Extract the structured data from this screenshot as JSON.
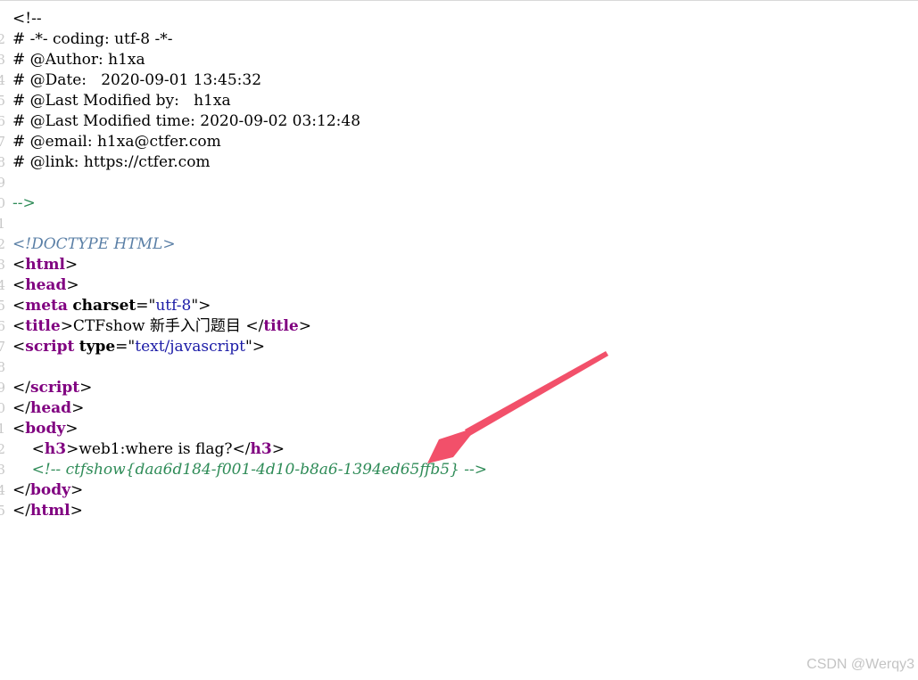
{
  "source": {
    "lines": [
      {
        "n": "",
        "parts": [
          {
            "t": "<!--",
            "c": "br"
          }
        ]
      },
      {
        "n": "2",
        "parts": [
          {
            "t": "# -*- coding: utf-8 -*-",
            "c": "br"
          }
        ]
      },
      {
        "n": "3",
        "parts": [
          {
            "t": "# @Author: h1xa",
            "c": "br"
          }
        ]
      },
      {
        "n": "4",
        "parts": [
          {
            "t": "# @Date:   2020-09-01 13:45:32",
            "c": "br"
          }
        ]
      },
      {
        "n": "5",
        "parts": [
          {
            "t": "# @Last Modified by:   h1xa",
            "c": "br"
          }
        ]
      },
      {
        "n": "6",
        "parts": [
          {
            "t": "# @Last Modified time: 2020-09-02 03:12:48",
            "c": "br"
          }
        ]
      },
      {
        "n": "7",
        "parts": [
          {
            "t": "# @email: h1xa@ctfer.com",
            "c": "br"
          }
        ]
      },
      {
        "n": "8",
        "parts": [
          {
            "t": "# @link: https://ctfer.com",
            "c": "br"
          }
        ]
      },
      {
        "n": "9",
        "parts": []
      },
      {
        "n": "0",
        "parts": [
          {
            "t": "-->",
            "c": "cmt"
          }
        ]
      },
      {
        "n": "1",
        "parts": []
      },
      {
        "n": "2",
        "parts": [
          {
            "t": "<!DOCTYPE HTML>",
            "c": "doct"
          }
        ]
      },
      {
        "n": "3",
        "parts": [
          {
            "t": "<",
            "c": "br"
          },
          {
            "t": "html",
            "c": "tag"
          },
          {
            "t": ">",
            "c": "br"
          }
        ]
      },
      {
        "n": "4",
        "parts": [
          {
            "t": "<",
            "c": "br"
          },
          {
            "t": "head",
            "c": "tag"
          },
          {
            "t": ">",
            "c": "br"
          }
        ]
      },
      {
        "n": "5",
        "parts": [
          {
            "t": "<",
            "c": "br"
          },
          {
            "t": "meta",
            "c": "tag"
          },
          {
            "t": " ",
            "c": "br"
          },
          {
            "t": "charset",
            "c": "attr"
          },
          {
            "t": "=\"",
            "c": "br"
          },
          {
            "t": "utf-8",
            "c": "val"
          },
          {
            "t": "\">",
            "c": "br"
          }
        ]
      },
      {
        "n": "6",
        "parts": [
          {
            "t": "<",
            "c": "br"
          },
          {
            "t": "title",
            "c": "tag"
          },
          {
            "t": ">CTFshow 新手入门题目 </",
            "c": "br"
          },
          {
            "t": "title",
            "c": "tag"
          },
          {
            "t": ">",
            "c": "br"
          }
        ]
      },
      {
        "n": "7",
        "parts": [
          {
            "t": "<",
            "c": "br"
          },
          {
            "t": "script",
            "c": "tag"
          },
          {
            "t": " ",
            "c": "br"
          },
          {
            "t": "type",
            "c": "attr"
          },
          {
            "t": "=\"",
            "c": "br"
          },
          {
            "t": "text/javascript",
            "c": "val"
          },
          {
            "t": "\">",
            "c": "br"
          }
        ]
      },
      {
        "n": "8",
        "parts": []
      },
      {
        "n": "9",
        "parts": [
          {
            "t": "</",
            "c": "br"
          },
          {
            "t": "script",
            "c": "tag"
          },
          {
            "t": ">",
            "c": "br"
          }
        ]
      },
      {
        "n": "0",
        "parts": [
          {
            "t": "</",
            "c": "br"
          },
          {
            "t": "head",
            "c": "tag"
          },
          {
            "t": ">",
            "c": "br"
          }
        ]
      },
      {
        "n": "1",
        "parts": [
          {
            "t": "<",
            "c": "br"
          },
          {
            "t": "body",
            "c": "tag"
          },
          {
            "t": ">",
            "c": "br"
          }
        ]
      },
      {
        "n": "2",
        "parts": [
          {
            "t": "    <",
            "c": "br"
          },
          {
            "t": "h3",
            "c": "tag"
          },
          {
            "t": ">web1:where is flag?</",
            "c": "br"
          },
          {
            "t": "h3",
            "c": "tag"
          },
          {
            "t": ">",
            "c": "br"
          }
        ]
      },
      {
        "n": "3",
        "parts": [
          {
            "t": "    <!-- ctfshow{daa6d184-f001-4d10-b8a6-1394ed65ffb5} -->",
            "c": "cmt-i"
          }
        ]
      },
      {
        "n": "4",
        "parts": [
          {
            "t": "</",
            "c": "br"
          },
          {
            "t": "body",
            "c": "tag"
          },
          {
            "t": ">",
            "c": "br"
          }
        ]
      },
      {
        "n": "5",
        "parts": [
          {
            "t": "</",
            "c": "br"
          },
          {
            "t": "html",
            "c": "tag"
          },
          {
            "t": ">",
            "c": "br"
          }
        ]
      }
    ]
  },
  "annotation": {
    "arrow_color": "#f2506a",
    "arrow_icon": "arrow-annotation-icon"
  },
  "watermark": {
    "text": "CSDN @Werqy3"
  }
}
